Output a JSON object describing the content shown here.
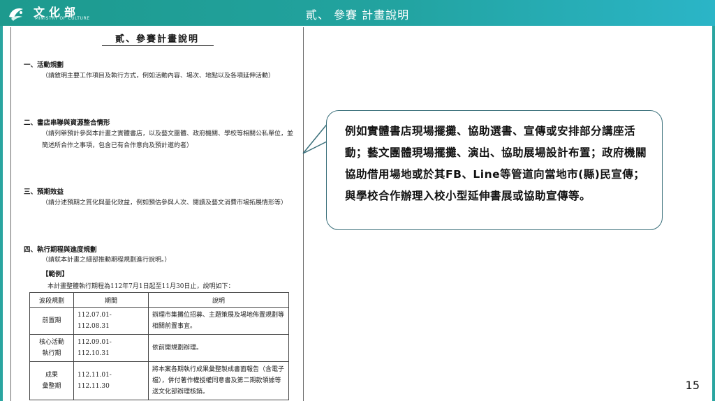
{
  "header": {
    "logo_cn": "文化部",
    "logo_en": "MINISTRY OF CULTURE",
    "title": "貳、 參賽 計畫說明",
    "colors": {
      "bar_start": "#1d9a8e",
      "bar_end": "#2bb5c7"
    }
  },
  "document": {
    "title": "貳、參賽計畫說明",
    "sections": [
      {
        "heading": "一、活動規劃",
        "text": "（請敘明主要工作項目及執行方式，例如活動內容、場次、地點以及各項延伸活動）"
      },
      {
        "heading": "二、書店串聯與資源整合情形",
        "text": "（請列舉預計參與本計畫之實體書店，以及藝文團體、政府機關、學校等相關公私單位，並簡述所合作之事項，包含已有合作意向及預計邀約者）"
      },
      {
        "heading": "三、預期效益",
        "text": "（請分述預期之質化與量化效益，例如預估參與人次、閱讀及藝文消費市場拓展情形等）"
      },
      {
        "heading": "四、執行期程與進度規劃",
        "text": "（請就本計畫之細部推動期程規劃進行說明。）"
      }
    ],
    "example_label": "【範例】",
    "example_text": "本計畫整體執行期程為112年7月1日起至11月30日止，說明如下：",
    "table": {
      "headers": [
        "波段規劃",
        "期間",
        "說明"
      ],
      "rows": [
        {
          "stage": "前置期",
          "period": "112.07.01-\n112.08.31",
          "desc": "辦理市集攤位招募、主題策展及場地佈置規劃等相關前置事宜。"
        },
        {
          "stage": "核心活動\n執行期",
          "period": "112.09.01-\n112.10.31",
          "desc": "依前開規劃辦理。"
        },
        {
          "stage": "成果\n彙整期",
          "period": "112.11.01-\n112.11.30",
          "desc": "將本案各期執行成果彙整製成書面報告（含電子檔），併付著作權授權同意書及第二期款領據等送文化部辦理核銷。"
        }
      ]
    }
  },
  "callout": {
    "text": "例如實體書店現場擺攤、協助選書、宣傳或安排部分講座活動；藝文團體現場擺攤、演出、協助展場設計布置；政府機關協助借用場地或於其FB、Line等管道向當地市(縣)民宣傳；與學校合作辦理入校小型延伸書展或協助宣傳等。",
    "border_color": "#3a6f7a"
  },
  "page_number": "15"
}
